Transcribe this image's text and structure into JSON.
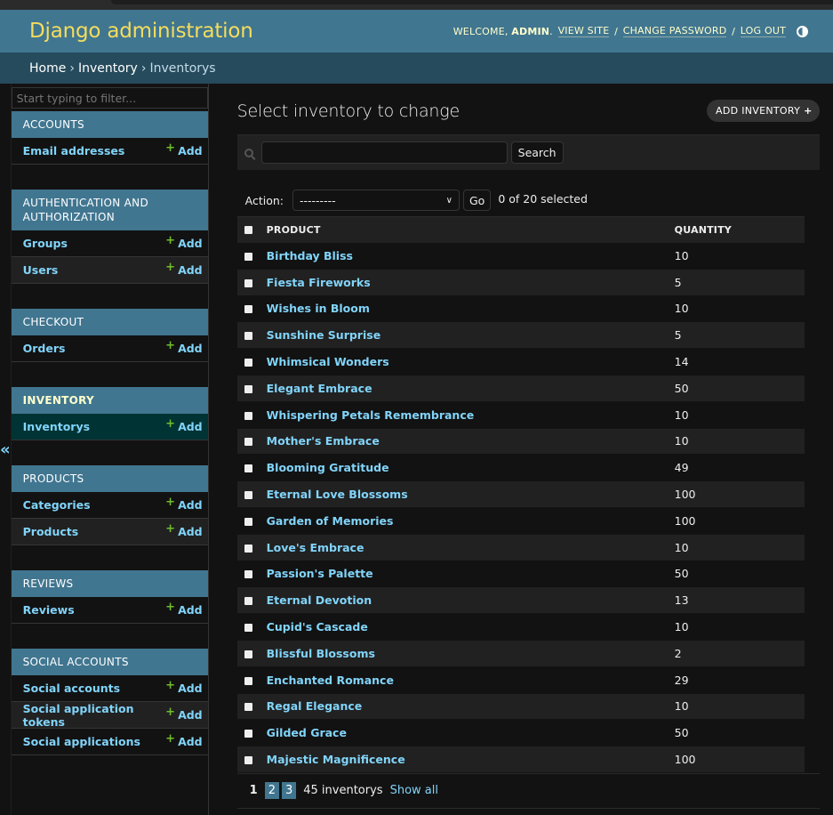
{
  "header": {
    "branding": "Django administration",
    "welcome": "WELCOME,",
    "username": "ADMIN",
    "view_site": "VIEW SITE",
    "change_password": "CHANGE PASSWORD",
    "log_out": "LOG OUT",
    "theme_icon": "contrast-half-circle-icon"
  },
  "breadcrumbs": [
    "Home",
    "Inventory",
    "Inventorys"
  ],
  "sidebar": {
    "collapse_icon": "«",
    "filter_placeholder": "Start typing to filter...",
    "add_label": "Add",
    "modules": [
      {
        "caption": "ACCOUNTS",
        "models": [
          "Email addresses"
        ]
      },
      {
        "caption": "AUTHENTICATION AND AUTHORIZATION",
        "models": [
          "Groups",
          "Users"
        ]
      },
      {
        "caption": "CHECKOUT",
        "models": [
          "Orders"
        ]
      },
      {
        "caption": "INVENTORY",
        "models": [
          "Inventorys"
        ],
        "active": true
      },
      {
        "caption": "PRODUCTS",
        "models": [
          "Categories",
          "Products"
        ]
      },
      {
        "caption": "REVIEWS",
        "models": [
          "Reviews"
        ]
      },
      {
        "caption": "SOCIAL ACCOUNTS",
        "models": [
          "Social accounts",
          "Social application tokens",
          "Social applications"
        ]
      }
    ]
  },
  "content": {
    "title": "Select inventory to change",
    "add_button": "ADD INVENTORY",
    "search_button": "Search",
    "search_value": "",
    "action_label": "Action:",
    "action_selected": "---------",
    "go_button": "Go",
    "action_counter": "0 of 20 selected",
    "columns": [
      "PRODUCT",
      "QUANTITY"
    ],
    "rows": [
      {
        "product": "Birthday Bliss",
        "quantity": "10"
      },
      {
        "product": "Fiesta Fireworks",
        "quantity": "5"
      },
      {
        "product": "Wishes in Bloom",
        "quantity": "10"
      },
      {
        "product": "Sunshine Surprise",
        "quantity": "5"
      },
      {
        "product": "Whimsical Wonders",
        "quantity": "14"
      },
      {
        "product": "Elegant Embrace",
        "quantity": "50"
      },
      {
        "product": "Whispering Petals Remembrance",
        "quantity": "10"
      },
      {
        "product": "Mother's Embrace",
        "quantity": "10"
      },
      {
        "product": "Blooming Gratitude",
        "quantity": "49"
      },
      {
        "product": "Eternal Love Blossoms",
        "quantity": "100"
      },
      {
        "product": "Garden of Memories",
        "quantity": "100"
      },
      {
        "product": "Love's Embrace",
        "quantity": "10"
      },
      {
        "product": "Passion's Palette",
        "quantity": "50"
      },
      {
        "product": "Eternal Devotion",
        "quantity": "13"
      },
      {
        "product": "Cupid's Cascade",
        "quantity": "10"
      },
      {
        "product": "Blissful Blossoms",
        "quantity": "2"
      },
      {
        "product": "Enchanted Romance",
        "quantity": "29"
      },
      {
        "product": "Regal Elegance",
        "quantity": "10"
      },
      {
        "product": "Gilded Grace",
        "quantity": "50"
      },
      {
        "product": "Majestic Magnificence",
        "quantity": "100"
      }
    ],
    "paginator": {
      "current": "1",
      "pages": [
        "2",
        "3"
      ],
      "count": "45 inventorys",
      "show_all": "Show all"
    }
  },
  "colors": {
    "header": "#417690",
    "breadcrumbs": "#264b5d",
    "branding": "#f5dd5d",
    "link": "#81d4fa",
    "add_plus": "#70bf2b",
    "current_model": "#003333"
  }
}
